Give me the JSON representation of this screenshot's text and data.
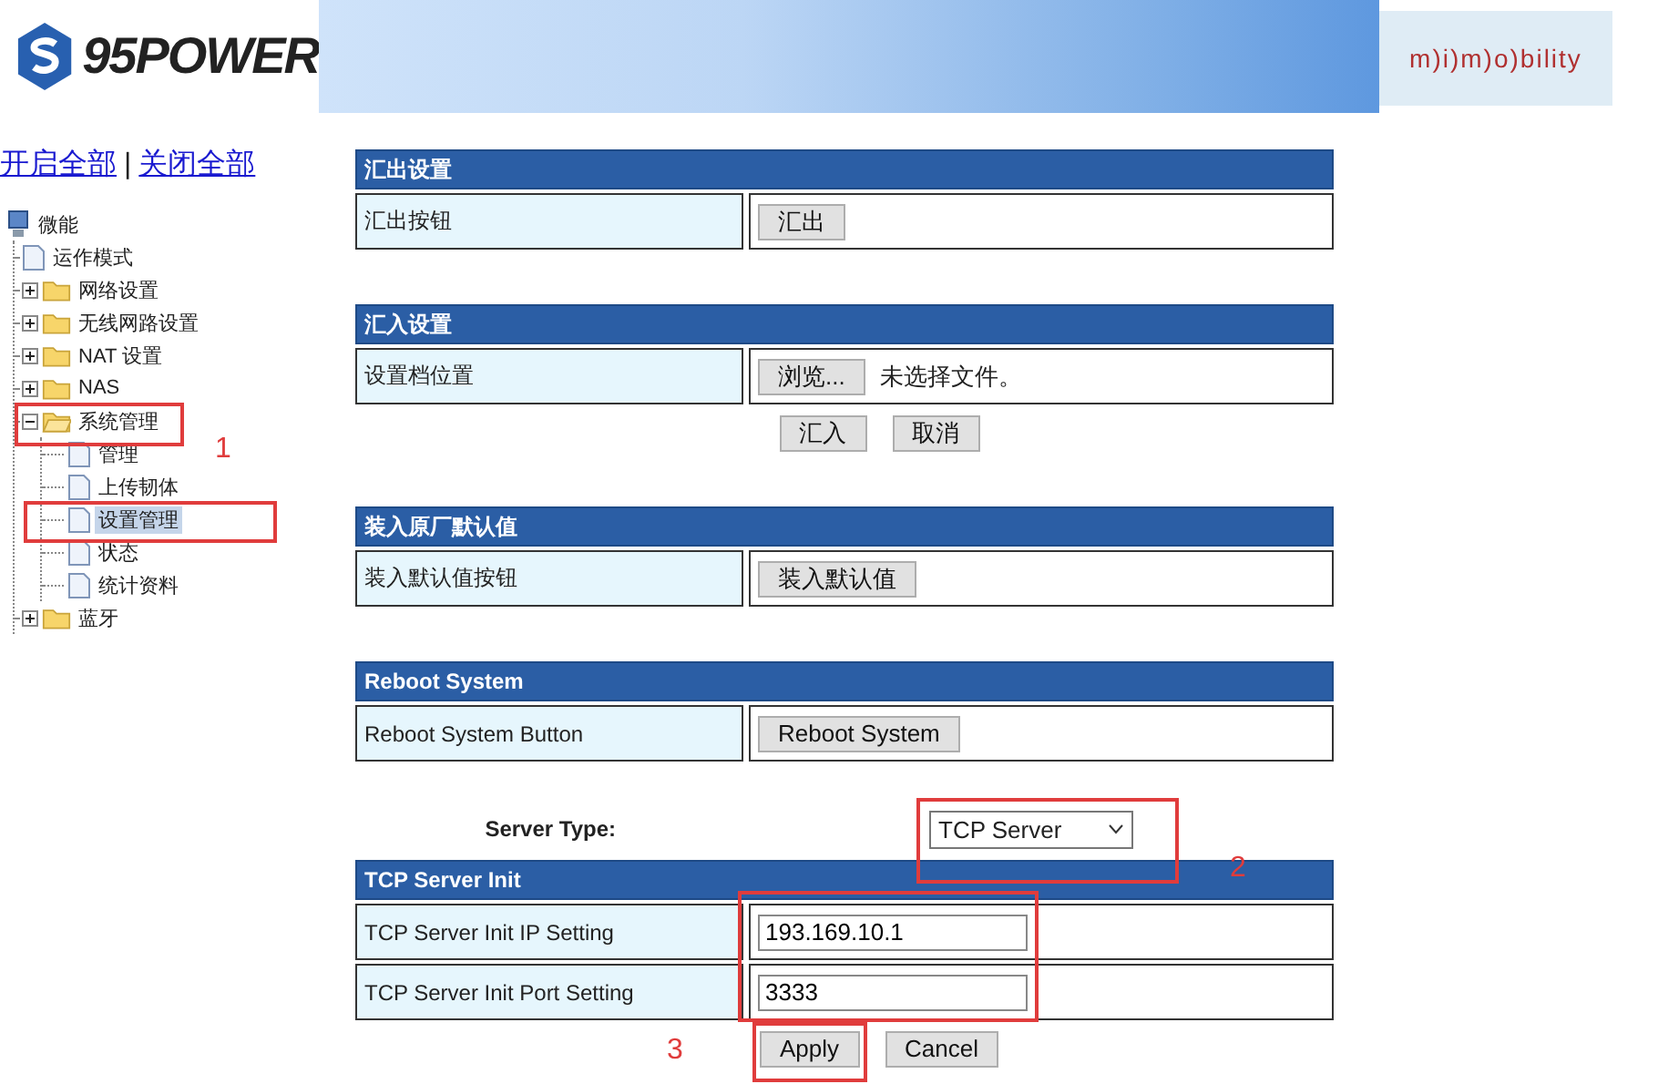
{
  "header": {
    "brand": "95POWER",
    "partner_logo": "m)i)m)o)bility"
  },
  "tree_links": [
    "开启全部",
    "关闭全部"
  ],
  "link_separator": "|",
  "tree": {
    "label": "微能",
    "children": [
      {
        "kind": "page",
        "label": "运作模式",
        "selected": false
      },
      {
        "kind": "folder",
        "label": "网络设置",
        "expanded": false,
        "selected": false
      },
      {
        "kind": "folder",
        "label": "无线网路设置",
        "expanded": false,
        "selected": false
      },
      {
        "kind": "folder",
        "label": "NAT 设置",
        "expanded": false,
        "selected": false
      },
      {
        "kind": "folder",
        "label": "NAS",
        "expanded": false,
        "selected": false
      },
      {
        "kind": "folder",
        "label": "系统管理",
        "expanded": true,
        "selected": false,
        "children": [
          {
            "kind": "page",
            "label": "管理",
            "selected": false
          },
          {
            "kind": "page",
            "label": "上传韧体",
            "selected": false
          },
          {
            "kind": "page",
            "label": "设置管理",
            "selected": true
          },
          {
            "kind": "page",
            "label": "状态",
            "selected": false
          },
          {
            "kind": "page",
            "label": "统计资料",
            "selected": false
          }
        ]
      },
      {
        "kind": "folder",
        "label": "蓝牙",
        "expanded": false,
        "selected": false
      }
    ]
  },
  "sections": [
    {
      "title": "汇出设置",
      "rows": [
        {
          "label": "汇出按钮",
          "controls": [
            {
              "kind": "button",
              "text": "汇出"
            }
          ]
        }
      ]
    },
    {
      "title": "汇入设置",
      "rows": [
        {
          "label": "设置档位置",
          "controls": [
            {
              "kind": "button",
              "text": "浏览..."
            },
            {
              "kind": "note",
              "text": "未选择文件。"
            }
          ]
        }
      ],
      "actions": [
        "汇入",
        "取消"
      ]
    },
    {
      "title": "装入原厂默认值",
      "rows": [
        {
          "label": "装入默认值按钮",
          "controls": [
            {
              "kind": "button",
              "text": "装入默认值"
            }
          ]
        }
      ]
    },
    {
      "title": "Reboot System",
      "rows": [
        {
          "label": "Reboot System Button",
          "controls": [
            {
              "kind": "button",
              "text": "Reboot System"
            }
          ]
        }
      ]
    },
    {
      "pre": {
        "label": "Server Type:",
        "value": "TCP Server"
      },
      "title": "TCP Server Init",
      "rows": [
        {
          "label": "TCP Server Init IP Setting",
          "controls": [
            {
              "kind": "input",
              "text": "193.169.10.1"
            }
          ]
        },
        {
          "label": "TCP Server Init Port Setting",
          "controls": [
            {
              "kind": "input",
              "text": "3333"
            }
          ]
        }
      ],
      "actions": [
        "Apply",
        "Cancel"
      ]
    }
  ],
  "annotations": [
    {
      "number": "1"
    },
    {
      "number": "2"
    },
    {
      "number": "3"
    }
  ]
}
